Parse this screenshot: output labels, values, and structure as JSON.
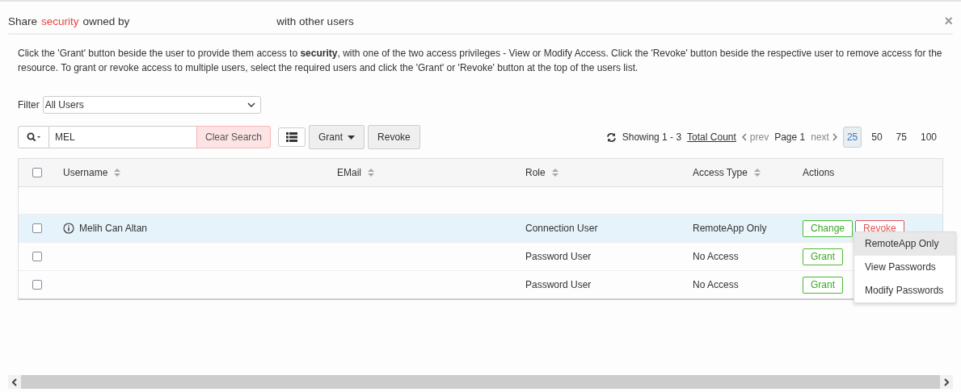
{
  "dialog": {
    "title": {
      "prefix": "Share",
      "resource": "security",
      "middle": "owned by",
      "suffix": "with other users"
    },
    "close": "×",
    "description": "Click the 'Grant' button beside the user to provide them access to **security**, with one of the two access privileges - View or Modify Access. Click the 'Revoke' button beside the respective user to remove access for the resource. To grant or revoke access to multiple users, select the required users and click the 'Grant' or 'Revoke' button at the top of the users list."
  },
  "filter": {
    "label": "Filter",
    "value": "All Users"
  },
  "toolbar": {
    "search_value": "MEL",
    "clear": "Clear Search",
    "grant": "Grant",
    "revoke": "Revoke"
  },
  "pagination": {
    "showing": "Showing 1 - 3",
    "total": "Total Count",
    "prev": "prev",
    "page": "Page 1",
    "next": "next",
    "sizes": [
      {
        "label": "25",
        "selected": true
      },
      {
        "label": "50",
        "selected": false
      },
      {
        "label": "75",
        "selected": false
      },
      {
        "label": "100",
        "selected": false
      }
    ]
  },
  "table": {
    "select_all_checked": false,
    "columns": [
      {
        "label": "Username",
        "sortable": true
      },
      {
        "label": "EMail",
        "sortable": true
      },
      {
        "label": "Role",
        "sortable": true
      },
      {
        "label": "Access Type",
        "sortable": true
      },
      {
        "label": "Actions",
        "sortable": false
      }
    ],
    "rows": [
      {
        "selected": true,
        "checked": false,
        "username": "Melih Can Altan",
        "info": true,
        "role": "Connection User",
        "access": "RemoteApp Only",
        "actions": [
          {
            "kind": "change",
            "label": "Change"
          },
          {
            "kind": "revoke",
            "label": "Revoke"
          }
        ]
      },
      {
        "selected": false,
        "checked": false,
        "info": false,
        "role": "Password User",
        "access": "No Access",
        "actions": [
          {
            "kind": "grant",
            "label": "Grant"
          }
        ]
      },
      {
        "selected": false,
        "checked": false,
        "info": false,
        "role": "Password User",
        "access": "No Access",
        "actions": [
          {
            "kind": "grant",
            "label": "Grant"
          }
        ]
      }
    ]
  },
  "menu": {
    "items": [
      {
        "label": "RemoteApp Only",
        "selected": true
      },
      {
        "label": "View Passwords",
        "selected": false
      },
      {
        "label": "Modify Passwords",
        "selected": false
      }
    ]
  }
}
